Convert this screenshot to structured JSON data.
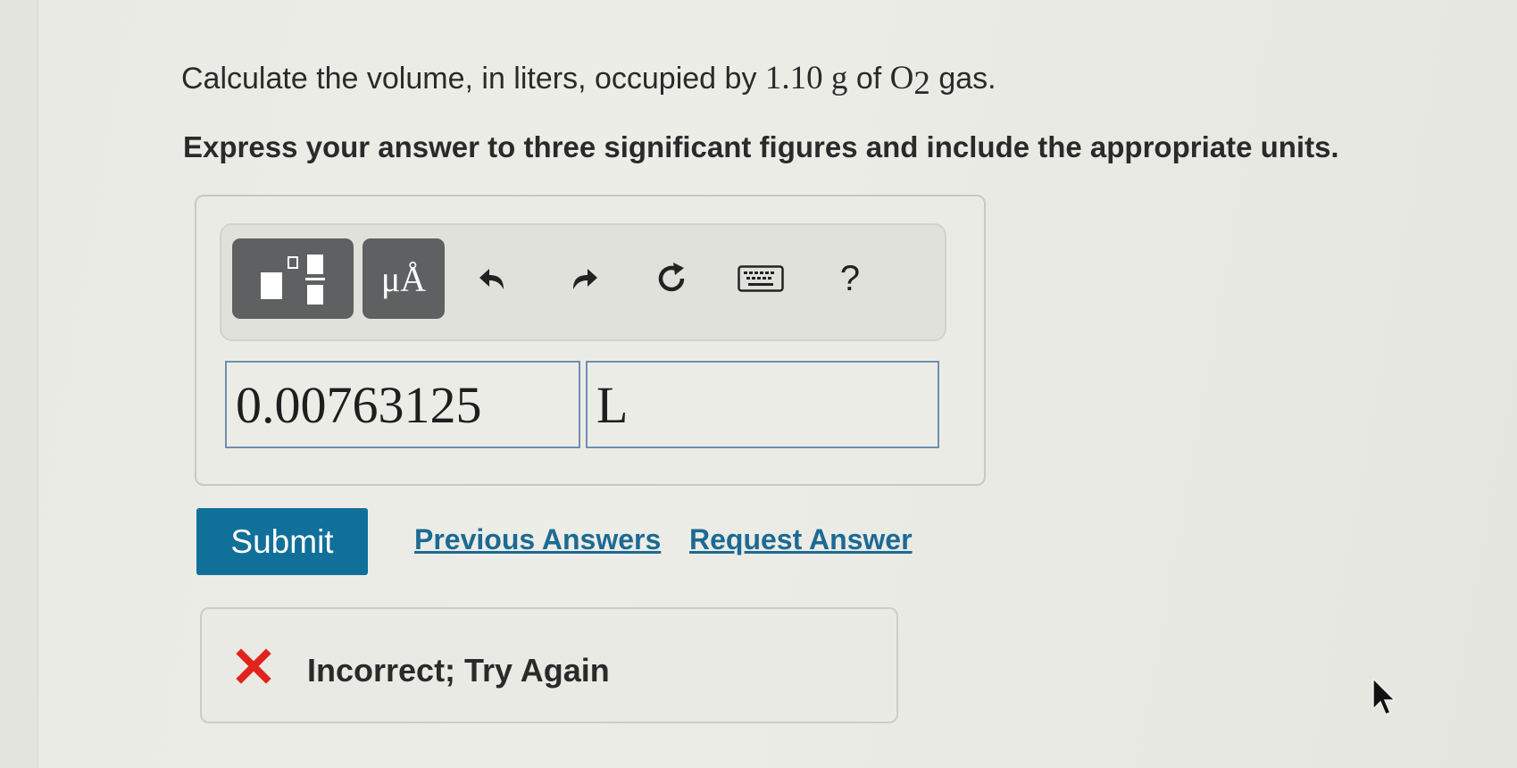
{
  "question": {
    "prefix": "Calculate the volume, in liters, occupied by ",
    "mass": "1.10 g",
    "middle": " of ",
    "formula": "O",
    "subscript": "2",
    "suffix": " gas."
  },
  "instruction": "Express your answer to three significant figures and include the appropriate units.",
  "toolbar": {
    "units_label": "μÅ",
    "help_label": "?",
    "icons": [
      "templates-icon",
      "units-icon",
      "undo-icon",
      "redo-icon",
      "reset-icon",
      "keyboard-icon",
      "help-icon"
    ]
  },
  "answer": {
    "value": "0.00763125",
    "unit": "L"
  },
  "actions": {
    "submit_label": "Submit",
    "previous_answers_label": "Previous Answers",
    "request_answer_label": "Request Answer"
  },
  "feedback": {
    "text": "Incorrect; Try Again"
  },
  "colors": {
    "submit": "#10709a",
    "link": "#1c6a94",
    "error": "#e0231b",
    "toolbar_button": "#5f6061"
  }
}
